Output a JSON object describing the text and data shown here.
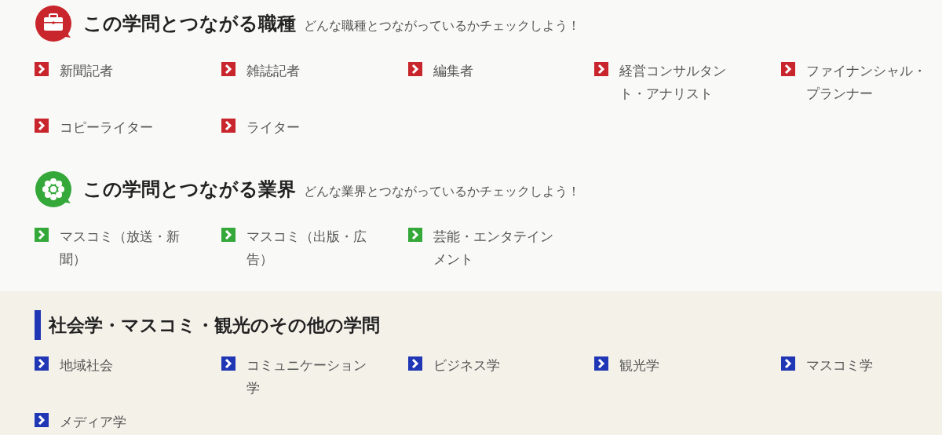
{
  "sections": [
    {
      "kind": "jobs",
      "title": "この学問とつながる職種",
      "subtitle": "どんな職種とつながっているかチェックしよう！",
      "items": [
        "新聞記者",
        "雑誌記者",
        "編集者",
        "経営コンサルタント・アナリスト",
        "ファイナンシャル・プランナー",
        "コピーライター",
        "ライター"
      ]
    },
    {
      "kind": "industries",
      "title": "この学問とつながる業界",
      "subtitle": "どんな業界とつながっているかチェックしよう！",
      "items": [
        "マスコミ（放送・新聞）",
        "マスコミ（出版・広告）",
        "芸能・エンタテインメント"
      ]
    },
    {
      "kind": "other",
      "title": "社会学・マスコミ・観光のその他の学問",
      "items": [
        "地域社会",
        "コミュニケーション学",
        "ビジネス学",
        "観光学",
        "マスコミ学",
        "メディア学"
      ]
    }
  ]
}
